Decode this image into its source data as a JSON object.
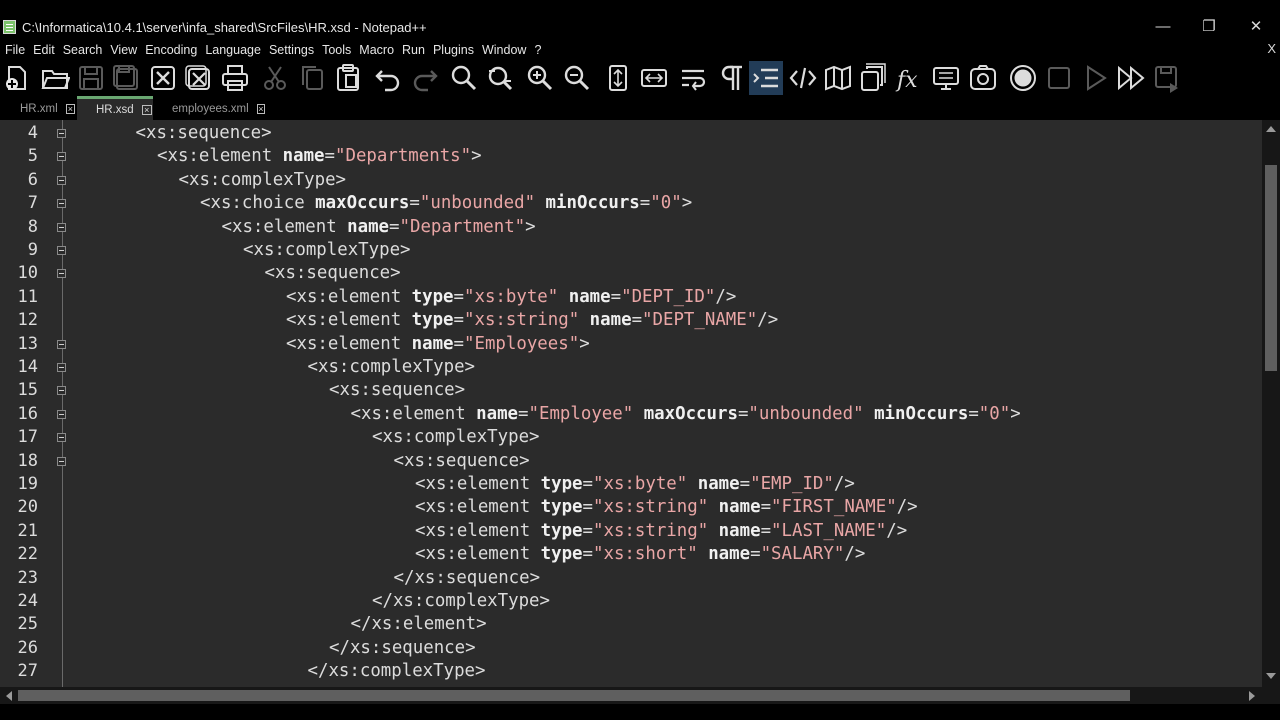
{
  "window": {
    "title": "C:\\Informatica\\10.4.1\\server\\infa_shared\\SrcFiles\\HR.xsd - Notepad++",
    "minimize_glyph": "—",
    "restore_glyph": "❐",
    "close_glyph": "✕"
  },
  "menu": {
    "items": [
      "File",
      "Edit",
      "Search",
      "View",
      "Encoding",
      "Language",
      "Settings",
      "Tools",
      "Macro",
      "Run",
      "Plugins",
      "Window",
      "?"
    ],
    "close_glyph": "X"
  },
  "toolbar": {
    "icons": [
      "new-file-icon",
      "open-folder-icon",
      "save-icon",
      "save-all-icon",
      "close-icon",
      "close-all-icon",
      "print-icon",
      "cut-icon",
      "copy-icon",
      "paste-icon",
      "undo-icon",
      "redo-icon",
      "find-icon",
      "replace-icon",
      "zoom-in-icon",
      "zoom-out-icon",
      "sync-vertical-icon",
      "sync-horizontal-icon",
      "word-wrap-icon",
      "show-all-characters-icon",
      "indent-guide-icon",
      "xml-tag-icon",
      "document-map-icon",
      "function-list-icon",
      "function-fx-icon",
      "monitor-icon",
      "folder-workspace-icon",
      "record-macro-icon",
      "stop-macro-icon",
      "play-macro-icon",
      "run-macro-multiple-icon",
      "save-macro-icon"
    ]
  },
  "tabs": [
    {
      "label": "HR.xml",
      "active": false
    },
    {
      "label": "HR.xsd",
      "active": true
    },
    {
      "label": "employees.xml",
      "active": false
    }
  ],
  "editor": {
    "lines": [
      {
        "num": "4",
        "indent": 3,
        "fold": true,
        "tokens": [
          [
            "tag",
            "<xs:sequence>"
          ]
        ]
      },
      {
        "num": "5",
        "indent": 4,
        "fold": true,
        "tokens": [
          [
            "tag",
            "<xs:element "
          ],
          [
            "attr",
            "name"
          ],
          [
            "eq",
            "="
          ],
          [
            "val",
            "\"Departments\""
          ],
          [
            "tag",
            ">"
          ]
        ]
      },
      {
        "num": "6",
        "indent": 5,
        "fold": true,
        "tokens": [
          [
            "tag",
            "<xs:complexType>"
          ]
        ]
      },
      {
        "num": "7",
        "indent": 6,
        "fold": true,
        "tokens": [
          [
            "tag",
            "<xs:choice "
          ],
          [
            "attr",
            "maxOccurs"
          ],
          [
            "eq",
            "="
          ],
          [
            "val",
            "\"unbounded\""
          ],
          [
            "tag",
            " "
          ],
          [
            "attr",
            "minOccurs"
          ],
          [
            "eq",
            "="
          ],
          [
            "val",
            "\"0\""
          ],
          [
            "tag",
            ">"
          ]
        ]
      },
      {
        "num": "8",
        "indent": 7,
        "fold": true,
        "tokens": [
          [
            "tag",
            "<xs:element "
          ],
          [
            "attr",
            "name"
          ],
          [
            "eq",
            "="
          ],
          [
            "val",
            "\"Department\""
          ],
          [
            "tag",
            ">"
          ]
        ]
      },
      {
        "num": "9",
        "indent": 8,
        "fold": true,
        "tokens": [
          [
            "tag",
            "<xs:complexType>"
          ]
        ]
      },
      {
        "num": "10",
        "indent": 9,
        "fold": true,
        "tokens": [
          [
            "tag",
            "<xs:sequence>"
          ]
        ]
      },
      {
        "num": "11",
        "indent": 10,
        "fold": false,
        "tokens": [
          [
            "tag",
            "<xs:element "
          ],
          [
            "attr",
            "type"
          ],
          [
            "eq",
            "="
          ],
          [
            "val",
            "\"xs:byte\""
          ],
          [
            "tag",
            " "
          ],
          [
            "attr",
            "name"
          ],
          [
            "eq",
            "="
          ],
          [
            "val",
            "\"DEPT_ID\""
          ],
          [
            "tag",
            "/>"
          ]
        ]
      },
      {
        "num": "12",
        "indent": 10,
        "fold": false,
        "tokens": [
          [
            "tag",
            "<xs:element "
          ],
          [
            "attr",
            "type"
          ],
          [
            "eq",
            "="
          ],
          [
            "val",
            "\"xs:string\""
          ],
          [
            "tag",
            " "
          ],
          [
            "attr",
            "name"
          ],
          [
            "eq",
            "="
          ],
          [
            "val",
            "\"DEPT_NAME\""
          ],
          [
            "tag",
            "/>"
          ]
        ]
      },
      {
        "num": "13",
        "indent": 10,
        "fold": true,
        "tokens": [
          [
            "tag",
            "<xs:element "
          ],
          [
            "attr",
            "name"
          ],
          [
            "eq",
            "="
          ],
          [
            "val",
            "\"Employees\""
          ],
          [
            "tag",
            ">"
          ]
        ]
      },
      {
        "num": "14",
        "indent": 11,
        "fold": true,
        "tokens": [
          [
            "tag",
            "<xs:complexType>"
          ]
        ]
      },
      {
        "num": "15",
        "indent": 12,
        "fold": true,
        "tokens": [
          [
            "tag",
            "<xs:sequence>"
          ]
        ]
      },
      {
        "num": "16",
        "indent": 13,
        "fold": true,
        "tokens": [
          [
            "tag",
            "<xs:element "
          ],
          [
            "attr",
            "name"
          ],
          [
            "eq",
            "="
          ],
          [
            "val",
            "\"Employee\""
          ],
          [
            "tag",
            " "
          ],
          [
            "attr",
            "maxOccurs"
          ],
          [
            "eq",
            "="
          ],
          [
            "val",
            "\"unbounded\""
          ],
          [
            "tag",
            " "
          ],
          [
            "attr",
            "minOccurs"
          ],
          [
            "eq",
            "="
          ],
          [
            "val",
            "\"0\""
          ],
          [
            "tag",
            ">"
          ]
        ]
      },
      {
        "num": "17",
        "indent": 14,
        "fold": true,
        "tokens": [
          [
            "tag",
            "<xs:complexType>"
          ]
        ]
      },
      {
        "num": "18",
        "indent": 15,
        "fold": true,
        "tokens": [
          [
            "tag",
            "<xs:sequence>"
          ]
        ]
      },
      {
        "num": "19",
        "indent": 16,
        "fold": false,
        "tokens": [
          [
            "tag",
            "<xs:element "
          ],
          [
            "attr",
            "type"
          ],
          [
            "eq",
            "="
          ],
          [
            "val",
            "\"xs:byte\""
          ],
          [
            "tag",
            " "
          ],
          [
            "attr",
            "name"
          ],
          [
            "eq",
            "="
          ],
          [
            "val",
            "\"EMP_ID\""
          ],
          [
            "tag",
            "/>"
          ]
        ]
      },
      {
        "num": "20",
        "indent": 16,
        "fold": false,
        "tokens": [
          [
            "tag",
            "<xs:element "
          ],
          [
            "attr",
            "type"
          ],
          [
            "eq",
            "="
          ],
          [
            "val",
            "\"xs:string\""
          ],
          [
            "tag",
            " "
          ],
          [
            "attr",
            "name"
          ],
          [
            "eq",
            "="
          ],
          [
            "val",
            "\"FIRST_NAME\""
          ],
          [
            "tag",
            "/>"
          ]
        ]
      },
      {
        "num": "21",
        "indent": 16,
        "fold": false,
        "tokens": [
          [
            "tag",
            "<xs:element "
          ],
          [
            "attr",
            "type"
          ],
          [
            "eq",
            "="
          ],
          [
            "val",
            "\"xs:string\""
          ],
          [
            "tag",
            " "
          ],
          [
            "attr",
            "name"
          ],
          [
            "eq",
            "="
          ],
          [
            "val",
            "\"LAST_NAME\""
          ],
          [
            "tag",
            "/>"
          ]
        ]
      },
      {
        "num": "22",
        "indent": 16,
        "fold": false,
        "tokens": [
          [
            "tag",
            "<xs:element "
          ],
          [
            "attr",
            "type"
          ],
          [
            "eq",
            "="
          ],
          [
            "val",
            "\"xs:short\""
          ],
          [
            "tag",
            " "
          ],
          [
            "attr",
            "name"
          ],
          [
            "eq",
            "="
          ],
          [
            "val",
            "\"SALARY\""
          ],
          [
            "tag",
            "/>"
          ]
        ]
      },
      {
        "num": "23",
        "indent": 15,
        "fold": false,
        "tokens": [
          [
            "tag",
            "</xs:sequence>"
          ]
        ]
      },
      {
        "num": "24",
        "indent": 14,
        "fold": false,
        "tokens": [
          [
            "tag",
            "</xs:complexType>"
          ]
        ]
      },
      {
        "num": "25",
        "indent": 13,
        "fold": false,
        "tokens": [
          [
            "tag",
            "</xs:element>"
          ]
        ]
      },
      {
        "num": "26",
        "indent": 12,
        "fold": false,
        "tokens": [
          [
            "tag",
            "</xs:sequence>"
          ]
        ]
      },
      {
        "num": "27",
        "indent": 11,
        "fold": false,
        "tokens": [
          [
            "tag",
            "</xs:complexType>"
          ]
        ]
      }
    ]
  },
  "colors": {
    "editor_bg": "#2b2b2b",
    "tag": "#dcdcdc",
    "attribute": "#f0f0f0",
    "value": "#e9a6a6",
    "active_tab_accent": "#6aa872"
  }
}
